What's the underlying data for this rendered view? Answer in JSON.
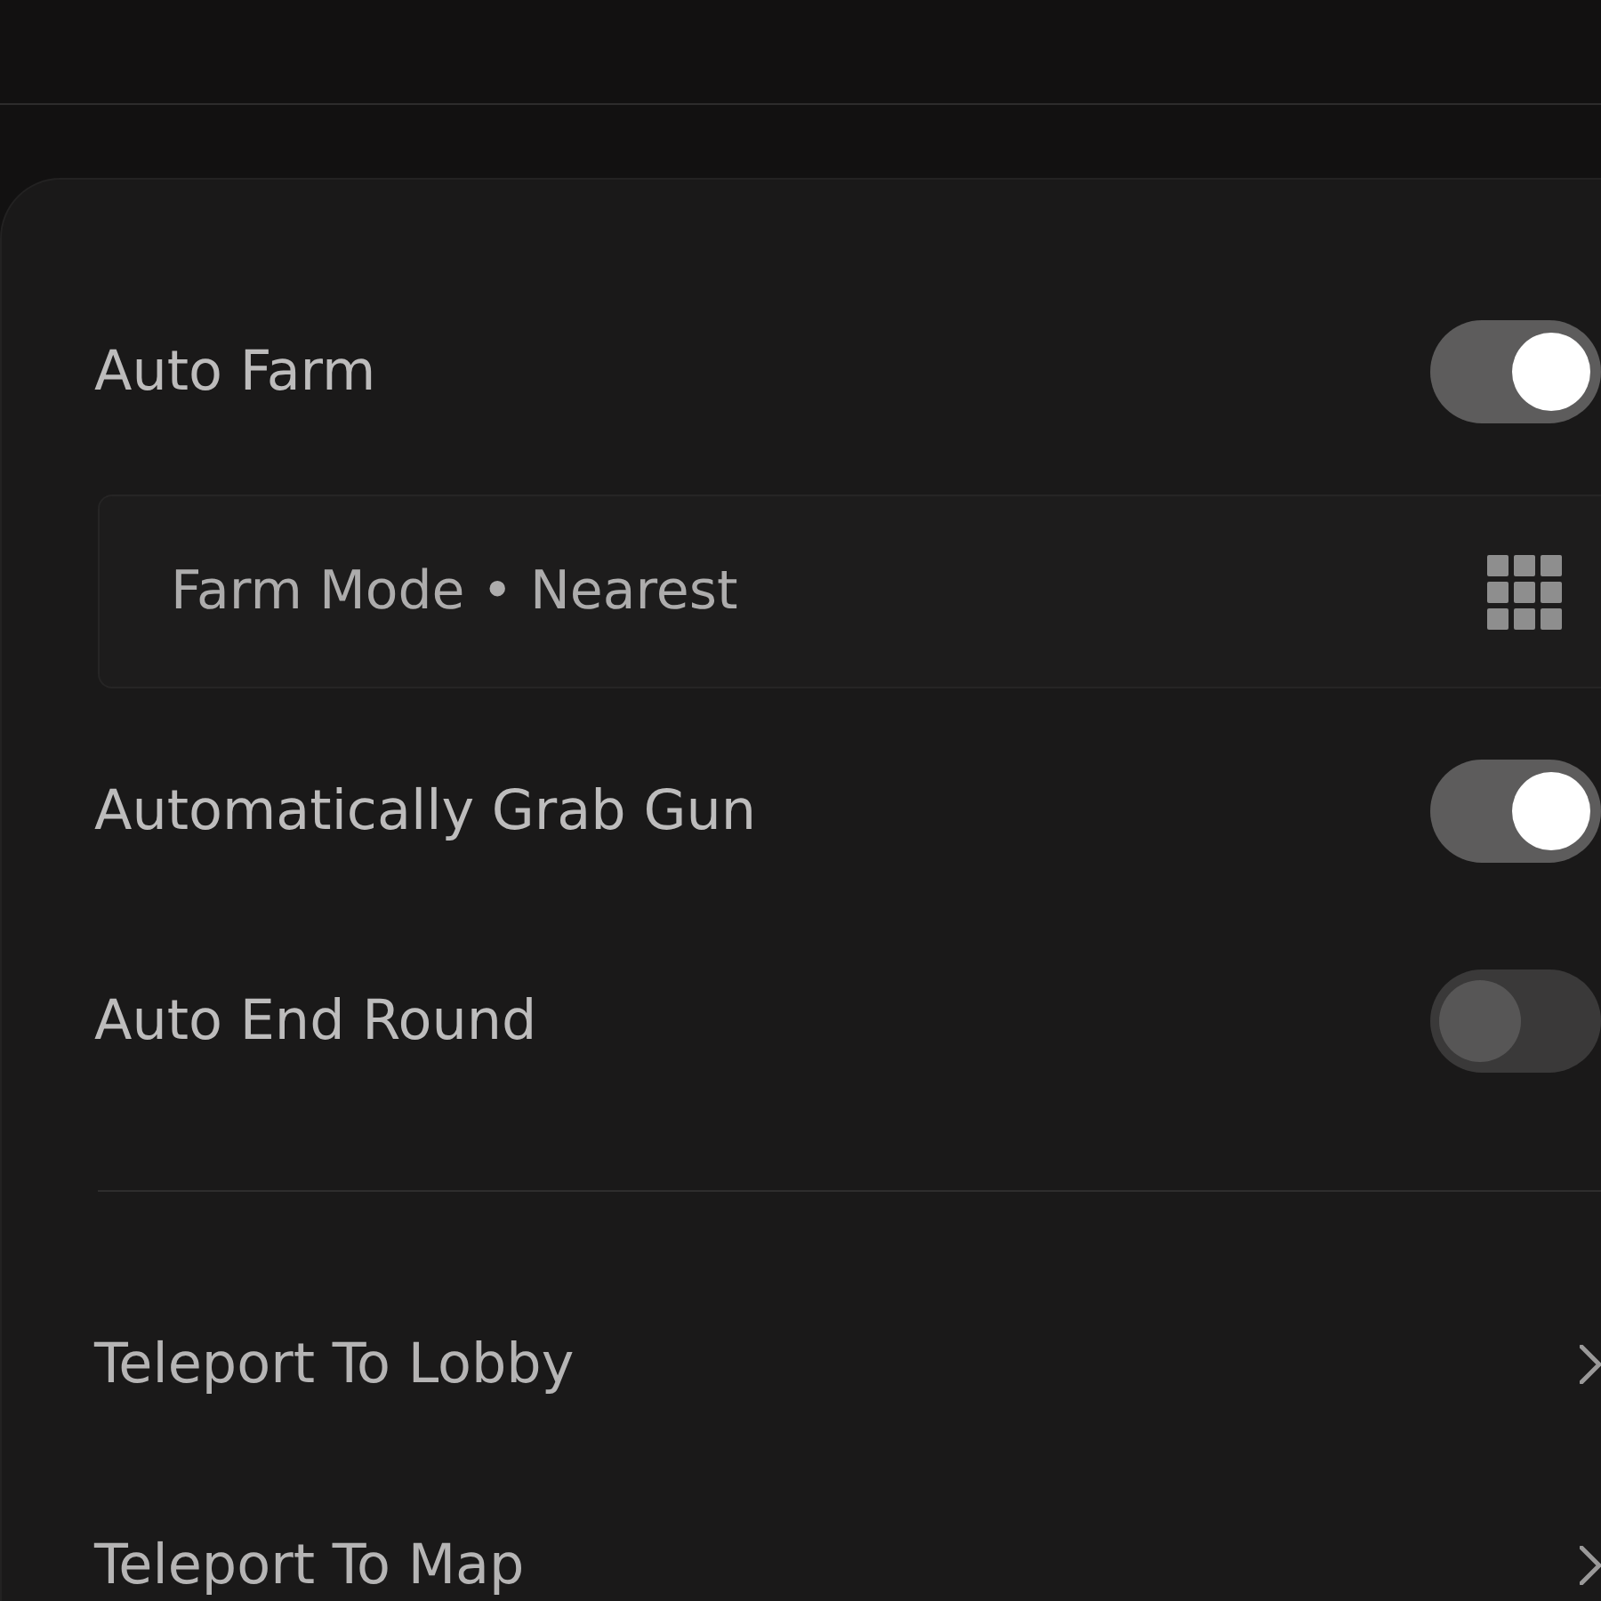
{
  "items": [
    {
      "kind": "toggle",
      "label": "Auto Farm",
      "on": true
    },
    {
      "kind": "dropdown",
      "label": "Farm Mode • Nearest"
    },
    {
      "kind": "toggle",
      "label": "Automatically Grab Gun",
      "on": true
    },
    {
      "kind": "toggle",
      "label": "Auto End Round",
      "on": false
    }
  ],
  "actions": [
    {
      "label": "Teleport To Lobby"
    },
    {
      "label": "Teleport To Map"
    }
  ]
}
